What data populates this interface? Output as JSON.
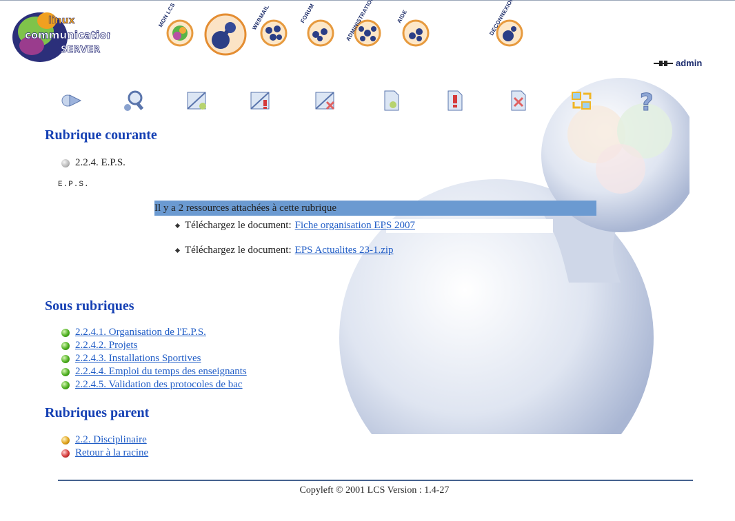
{
  "logo": {
    "line1": "linux",
    "line2": "communication",
    "line3": "SERVER"
  },
  "nav": {
    "items": [
      {
        "label": "MON LCS"
      },
      {
        "label": ""
      },
      {
        "label": "WEBMAIL"
      },
      {
        "label": "FORUM"
      },
      {
        "label": "ADMINISTRATION"
      },
      {
        "label": "AIDE"
      },
      {
        "label": "DECONNEXION"
      }
    ]
  },
  "user": {
    "name": "admin"
  },
  "current": {
    "heading": "Rubrique courante",
    "title": "2.2.4. E.P.S.",
    "description": "E.P.S."
  },
  "resources": {
    "header": "Il y a 2 ressources attachées à cette rubrique",
    "items": [
      {
        "prefix": "Téléchargez le document:",
        "link": "Fiche organisation EPS 2007"
      },
      {
        "prefix": "Téléchargez le document:",
        "link": "EPS Actualites 23-1.zip"
      }
    ]
  },
  "sub": {
    "heading": "Sous rubriques",
    "items": [
      "2.2.4.1. Organisation de l'E.P.S.",
      "2.2.4.2. Projets",
      "2.2.4.3. Installations Sportives",
      "2.2.4.4. Emploi du temps des enseignants",
      "2.2.4.5. Validation des protocoles de bac"
    ]
  },
  "parent": {
    "heading": "Rubriques parent",
    "items": [
      "2.2. Disciplinaire",
      "Retour à la racine"
    ]
  },
  "footer": {
    "text": "Copyleft © 2001 LCS Version : 1.4-27"
  },
  "colors": {
    "heading": "#1641b4",
    "link": "#1f5cc6",
    "resource_bar": "#6b9ad1",
    "ball_green": "#4caf1e",
    "ball_orange": "#e0a21a",
    "ball_red": "#d53a3a"
  },
  "toolbar_icons": [
    "arrow-icon",
    "search-icon",
    "new-folder-icon",
    "folder-warning-icon",
    "delete-folder-icon",
    "new-document-icon",
    "document-warning-icon",
    "delete-document-icon",
    "refresh-icon",
    "help-icon"
  ]
}
